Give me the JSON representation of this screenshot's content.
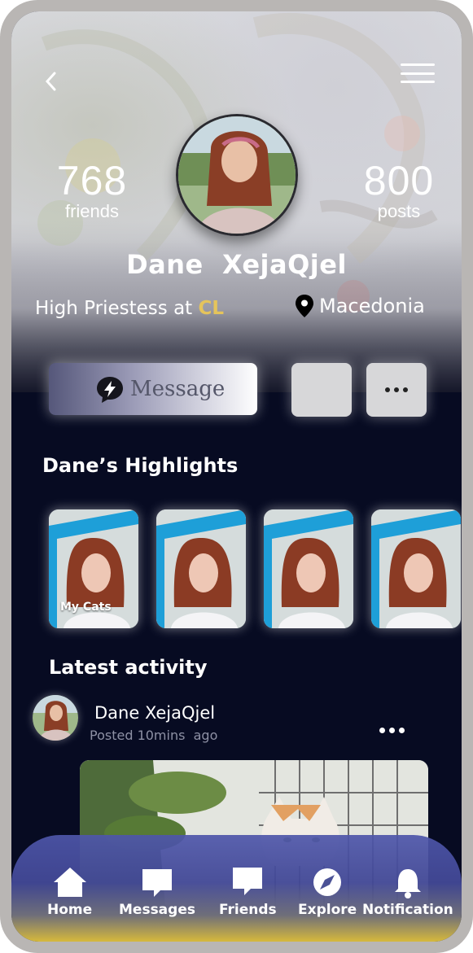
{
  "header": {
    "friends_count": "768",
    "friends_label": "friends",
    "posts_count": "800",
    "posts_label": "posts",
    "profile_name": "Dane  XejaQjel",
    "job_prefix": "High Priestess at ",
    "job_company": "CL",
    "location": "Macedonia"
  },
  "actions": {
    "message_label": "Message"
  },
  "highlights": {
    "title": "Dane’s Highlights",
    "items": [
      {
        "caption": "My Cats"
      },
      {
        "caption": ""
      },
      {
        "caption": ""
      },
      {
        "caption": ""
      }
    ]
  },
  "activity": {
    "title": "Latest activity",
    "post": {
      "author": "Dane XejaQjel",
      "time": "Posted 10mins  ago"
    }
  },
  "nav": {
    "items": [
      {
        "label": "Home",
        "icon": "home-icon"
      },
      {
        "label": "Messages",
        "icon": "messages-icon"
      },
      {
        "label": "Friends",
        "icon": "friends-icon"
      },
      {
        "label": "Explore",
        "icon": "compass-icon"
      },
      {
        "label": "Notification",
        "icon": "bell-icon"
      }
    ]
  },
  "colors": {
    "background": "#070b22",
    "accent_company": "#e5c45b",
    "nav_gradient_top": "#4e56aa",
    "nav_gradient_bottom": "#d6b93c"
  }
}
